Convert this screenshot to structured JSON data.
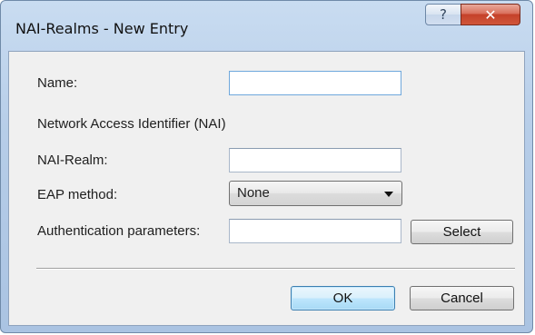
{
  "window": {
    "title": "NAI-Realms - New Entry",
    "help_glyph": "?",
    "close_glyph": "✕"
  },
  "form": {
    "name_label": "Name:",
    "name_value": "",
    "section_label": "Network Access Identifier (NAI)",
    "realm_label": "NAI-Realm:",
    "realm_value": "",
    "eap_label": "EAP method:",
    "eap_value": "None",
    "auth_label": "Authentication parameters:",
    "auth_value": "",
    "select_label": "Select"
  },
  "footer": {
    "ok_label": "OK",
    "cancel_label": "Cancel"
  }
}
